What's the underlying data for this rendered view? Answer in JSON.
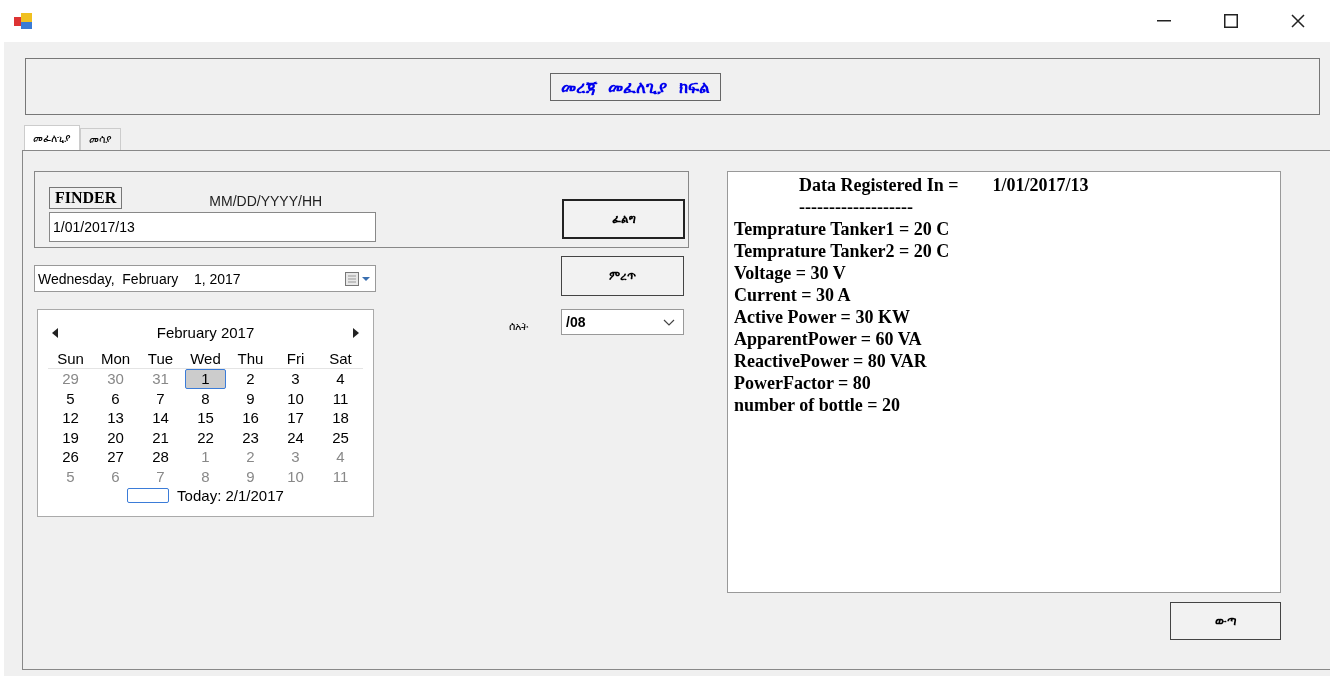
{
  "header": {
    "title": "መረጃ  መፈለጊያ  ክፍል"
  },
  "tabs": [
    {
      "label": "መፈለጊያ",
      "selected": true
    },
    {
      "label": "መሳያ",
      "selected": false
    }
  ],
  "finder": {
    "label": "FINDER",
    "format_hint": "MM/DD/YYYY/HH",
    "value": "1/01/2017/13",
    "search_button": "ፈልግ"
  },
  "date_picker": {
    "weekday": "Wednesday,",
    "month": "February",
    "day": "1, 2017"
  },
  "select_button": "ምረጥ",
  "hour": {
    "label": "ሰአት",
    "value": "/08"
  },
  "calendar": {
    "title": "February 2017",
    "weekdays": [
      "Sun",
      "Mon",
      "Tue",
      "Wed",
      "Thu",
      "Fri",
      "Sat"
    ],
    "weeks": [
      [
        {
          "n": "29",
          "other": true,
          "selected": false
        },
        {
          "n": "30",
          "other": true,
          "selected": false
        },
        {
          "n": "31",
          "other": true,
          "selected": false
        },
        {
          "n": "1",
          "other": false,
          "selected": true
        },
        {
          "n": "2",
          "other": false,
          "selected": false
        },
        {
          "n": "3",
          "other": false,
          "selected": false
        },
        {
          "n": "4",
          "other": false,
          "selected": false
        }
      ],
      [
        {
          "n": "5",
          "other": false,
          "selected": false
        },
        {
          "n": "6",
          "other": false,
          "selected": false
        },
        {
          "n": "7",
          "other": false,
          "selected": false
        },
        {
          "n": "8",
          "other": false,
          "selected": false
        },
        {
          "n": "9",
          "other": false,
          "selected": false
        },
        {
          "n": "10",
          "other": false,
          "selected": false
        },
        {
          "n": "11",
          "other": false,
          "selected": false
        }
      ],
      [
        {
          "n": "12",
          "other": false,
          "selected": false
        },
        {
          "n": "13",
          "other": false,
          "selected": false
        },
        {
          "n": "14",
          "other": false,
          "selected": false
        },
        {
          "n": "15",
          "other": false,
          "selected": false
        },
        {
          "n": "16",
          "other": false,
          "selected": false
        },
        {
          "n": "17",
          "other": false,
          "selected": false
        },
        {
          "n": "18",
          "other": false,
          "selected": false
        }
      ],
      [
        {
          "n": "19",
          "other": false,
          "selected": false
        },
        {
          "n": "20",
          "other": false,
          "selected": false
        },
        {
          "n": "21",
          "other": false,
          "selected": false
        },
        {
          "n": "22",
          "other": false,
          "selected": false
        },
        {
          "n": "23",
          "other": false,
          "selected": false
        },
        {
          "n": "24",
          "other": false,
          "selected": false
        },
        {
          "n": "25",
          "other": false,
          "selected": false
        }
      ],
      [
        {
          "n": "26",
          "other": false,
          "selected": false
        },
        {
          "n": "27",
          "other": false,
          "selected": false
        },
        {
          "n": "28",
          "other": false,
          "selected": false
        },
        {
          "n": "1",
          "other": true,
          "selected": false
        },
        {
          "n": "2",
          "other": true,
          "selected": false
        },
        {
          "n": "3",
          "other": true,
          "selected": false
        },
        {
          "n": "4",
          "other": true,
          "selected": false
        }
      ],
      [
        {
          "n": "5",
          "other": true,
          "selected": false
        },
        {
          "n": "6",
          "other": true,
          "selected": false
        },
        {
          "n": "7",
          "other": true,
          "selected": false
        },
        {
          "n": "8",
          "other": true,
          "selected": false
        },
        {
          "n": "9",
          "other": true,
          "selected": false
        },
        {
          "n": "10",
          "other": true,
          "selected": false
        },
        {
          "n": "11",
          "other": true,
          "selected": false
        }
      ]
    ],
    "today": "Today: 2/1/2017"
  },
  "output": {
    "heading_label": "Data Registered In =",
    "heading_value": "1/01/2017/13",
    "divider": "-------------------",
    "lines": [
      "Temprature Tanker1 = 20 C",
      "Temprature Tanker2 = 20 C",
      "Voltage = 30 V",
      "Current = 30 A",
      "Active Power = 30 KW",
      "ApparentPower = 60 VA",
      "ReactivePower = 80 VAR",
      "PowerFactor = 80",
      "number of bottle = 20"
    ]
  },
  "exit_button": "ውጣ"
}
